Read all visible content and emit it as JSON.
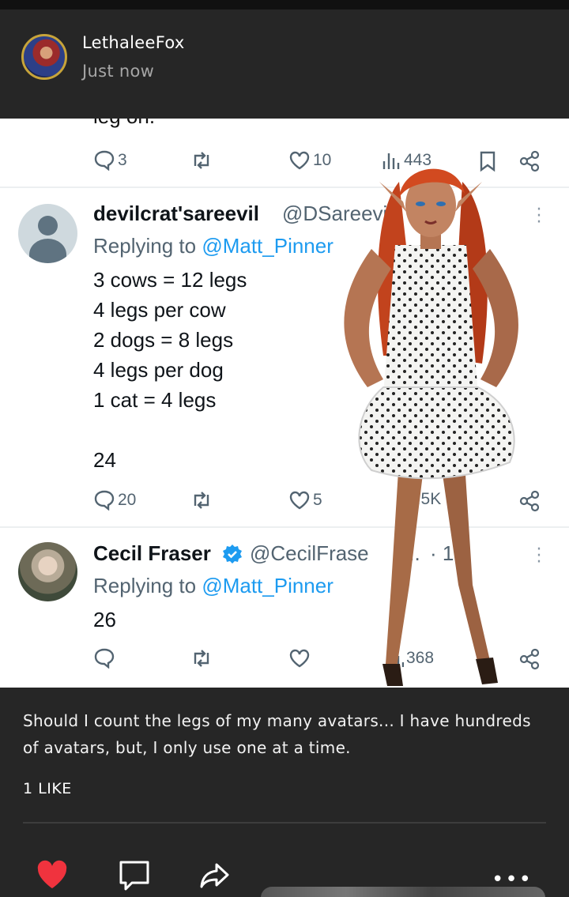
{
  "post": {
    "author": "LethaleeFox",
    "time": "Just now",
    "caption": "Should I count the legs of my many avatars... I have hundreds of avatars,  but, I only use one at a  time.",
    "likes_label": "1 LIKE"
  },
  "screenshot": {
    "cut_text": "leg on.",
    "tweet0_actions": {
      "replies": "3",
      "likes": "10",
      "views": "443"
    },
    "tweet1": {
      "name": "devilcrat'sareevil",
      "handle": "@DSareevi",
      "replying_prefix": "Replying to",
      "replying_to": "@Matt_Pinner",
      "lines": [
        "3 cows = 12 legs",
        "4 legs per cow",
        "2 dogs = 8 legs",
        "4 legs per dog",
        "1 cat = 4 legs"
      ],
      "answer": "24",
      "replies": "20",
      "likes": "5",
      "views": "1.5K"
    },
    "tweet2": {
      "name": "Cecil Fraser",
      "handle": "@CecilFrase",
      "ellipsis": "...",
      "time": "· 1h",
      "replying_prefix": "Replying to",
      "replying_to": "@Matt_Pinner",
      "answer": "26",
      "views": "368"
    }
  },
  "icons": {
    "like": "heart-filled-icon",
    "comment": "comment-icon",
    "share": "share-icon",
    "menu": "more-icon"
  },
  "colors": {
    "like_red": "#f0333e",
    "twitter_blue": "#1d9bf0",
    "verified": "#1d9bf0"
  }
}
